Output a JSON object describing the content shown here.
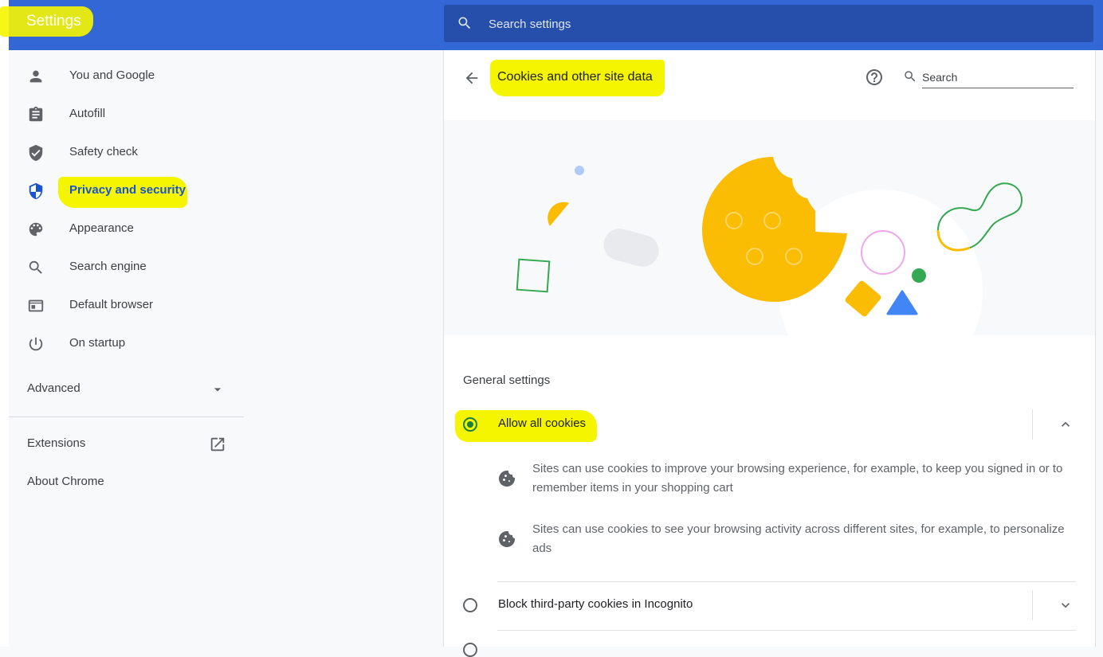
{
  "header": {
    "title": "Settings",
    "search_placeholder": "Search settings"
  },
  "sidebar": {
    "items": [
      {
        "label": "You and Google",
        "icon": "person-icon"
      },
      {
        "label": "Autofill",
        "icon": "clipboard-icon"
      },
      {
        "label": "Safety check",
        "icon": "shield-check-icon"
      },
      {
        "label": "Privacy and security",
        "icon": "shield-privacy-icon",
        "active": true
      },
      {
        "label": "Appearance",
        "icon": "palette-icon"
      },
      {
        "label": "Search engine",
        "icon": "search-icon"
      },
      {
        "label": "Default browser",
        "icon": "browser-window-icon"
      },
      {
        "label": "On startup",
        "icon": "power-icon"
      }
    ],
    "advanced_label": "Advanced",
    "extensions_label": "Extensions",
    "about_label": "About Chrome"
  },
  "page": {
    "title": "Cookies and other site data",
    "search_placeholder": "Search",
    "section_title": "General settings",
    "options": [
      {
        "label": "Allow all cookies",
        "selected": true,
        "expanded": true,
        "details": [
          "Sites can use cookies to improve your browsing experience, for example, to keep you signed in or to remember items in your shopping cart",
          "Sites can use cookies to see your browsing activity across different sites, for example, to personalize ads"
        ]
      },
      {
        "label": "Block third-party cookies in Incognito",
        "selected": false,
        "expanded": false
      }
    ]
  },
  "colors": {
    "header_bg": "#3367d6",
    "search_bg": "#254fab",
    "accent_blue": "#1a53d1",
    "radio_green": "#188038",
    "highlight_yellow": "#f5f500",
    "cookie_yellow": "#fbbc04"
  }
}
